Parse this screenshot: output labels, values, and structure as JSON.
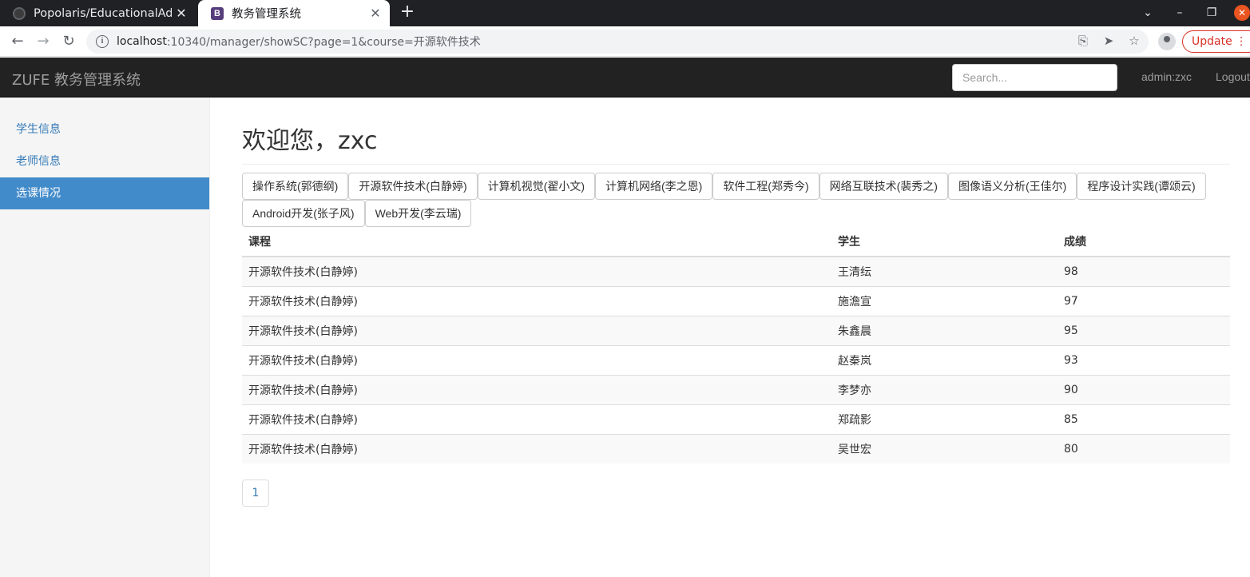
{
  "browser": {
    "tabs": [
      {
        "title": "Popolaris/EducationalAdm",
        "active": false
      },
      {
        "title": "教务管理系统",
        "active": true
      }
    ],
    "url_host": "localhost",
    "url_path": ":10340/manager/showSC?page=1&course=开源软件技术",
    "update_label": "Update"
  },
  "navbar": {
    "brand": "ZUFE 教务管理系统",
    "search_placeholder": "Search...",
    "user": "admin:zxc",
    "logout": "Logout"
  },
  "sidebar": {
    "items": [
      {
        "label": "学生信息"
      },
      {
        "label": "老师信息"
      },
      {
        "label": "选课情况"
      }
    ]
  },
  "main": {
    "heading": "欢迎您，zxc",
    "courses": [
      "操作系统(郭德纲)",
      "开源软件技术(白静婷)",
      "计算机视觉(翟小文)",
      "计算机网络(李之恩)",
      "软件工程(郑秀今)",
      "网络互联技术(裴秀之)",
      "图像语义分析(王佳尔)",
      "程序设计实践(谭颂云)",
      "Android开发(张子风)",
      "Web开发(李云瑞)"
    ],
    "table": {
      "headers": [
        "课程",
        "学生",
        "成绩"
      ],
      "rows": [
        [
          "开源软件技术(白静婷)",
          "王清纭",
          "98"
        ],
        [
          "开源软件技术(白静婷)",
          "施澹宣",
          "97"
        ],
        [
          "开源软件技术(白静婷)",
          "朱鑫晨",
          "95"
        ],
        [
          "开源软件技术(白静婷)",
          "赵秦岚",
          "93"
        ],
        [
          "开源软件技术(白静婷)",
          "李梦亦",
          "90"
        ],
        [
          "开源软件技术(白静婷)",
          "郑疏影",
          "85"
        ],
        [
          "开源软件技术(白静婷)",
          "吴世宏",
          "80"
        ]
      ]
    },
    "pagination": [
      "1"
    ]
  }
}
